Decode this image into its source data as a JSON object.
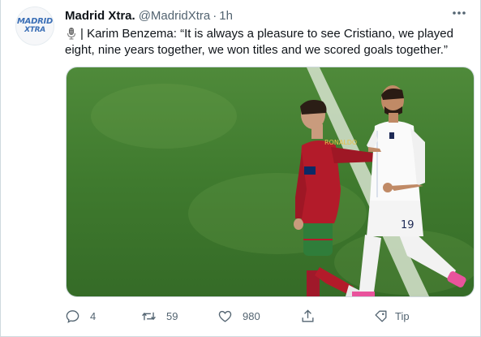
{
  "tweet": {
    "author_name": "Madrid Xtra.",
    "handle": "@MadridXtra",
    "separator": "·",
    "time": "1h",
    "avatar_line1": "MADRID",
    "avatar_line2": "XTRA",
    "text": "| Karim Benzema: “It is always a pleasure to see Cristiano, we played eight, nine years together, we won titles and we scored goals together.”",
    "media_icon": "microphone-icon",
    "media_description": "photo"
  },
  "actions": {
    "replies": "4",
    "retweets": "59",
    "likes": "980",
    "tip_label": "Tip"
  },
  "colors": {
    "text_primary": "#0f1419",
    "text_secondary": "#536471",
    "pitch": "#3c7a2e",
    "portugal_red": "#b31b2a",
    "france_white": "#f2f2f2"
  }
}
